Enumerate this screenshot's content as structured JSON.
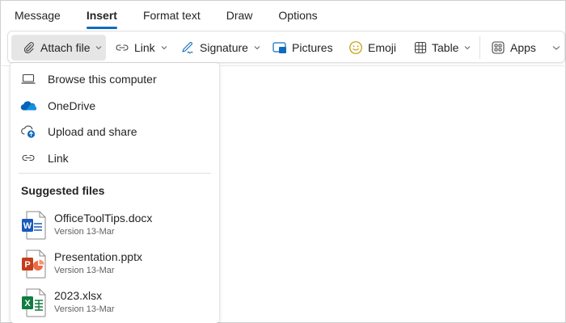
{
  "tabs": [
    {
      "label": "Message"
    },
    {
      "label": "Insert"
    },
    {
      "label": "Format text"
    },
    {
      "label": "Draw"
    },
    {
      "label": "Options"
    }
  ],
  "ribbon": {
    "attach_file": "Attach file",
    "link": "Link",
    "signature": "Signature",
    "pictures": "Pictures",
    "emoji": "Emoji",
    "table": "Table",
    "apps": "Apps"
  },
  "menu": {
    "items": [
      {
        "label": "Browse this computer",
        "icon": "laptop-icon"
      },
      {
        "label": "OneDrive",
        "icon": "onedrive-cloud-icon"
      },
      {
        "label": "Upload and share",
        "icon": "cloud-upload-icon"
      },
      {
        "label": "Link",
        "icon": "link-icon"
      }
    ],
    "section_title": "Suggested files",
    "files": [
      {
        "name": "OfficeToolTips.docx",
        "version": "Version 13-Mar",
        "type": "word",
        "color": "#185abd"
      },
      {
        "name": "Presentation.pptx",
        "version": "Version 13-Mar",
        "type": "powerpoint",
        "color": "#c43e1c"
      },
      {
        "name": "2023.xlsx",
        "version": "Version 13-Mar",
        "type": "excel",
        "color": "#107c41"
      }
    ]
  },
  "colors": {
    "accent": "#0f6cbd",
    "onedrive": "#0364b8"
  }
}
